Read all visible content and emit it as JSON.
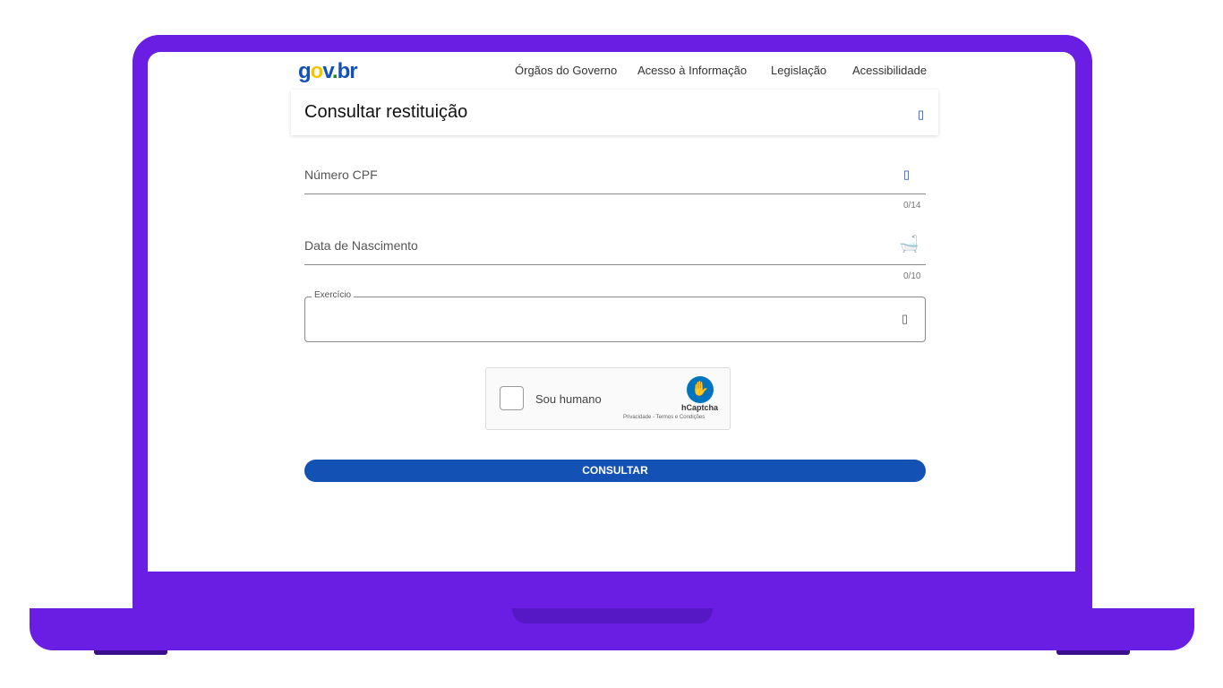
{
  "header": {
    "logo_parts": [
      "g",
      "o",
      "v",
      ".",
      "br"
    ],
    "nav": [
      "Órgãos do Governo",
      "Acesso à Informação",
      "Legislação",
      "Acessibilidade"
    ]
  },
  "page": {
    "title": "Consultar restituição"
  },
  "form": {
    "cpf": {
      "label": "Número CPF",
      "counter": "0/14",
      "icon": "info-icon"
    },
    "birth": {
      "label": "Data de Nascimento",
      "counter": "0/10",
      "icon": "calendar-icon"
    },
    "year": {
      "label": "Exercício",
      "icon": "dropdown-icon"
    }
  },
  "captcha": {
    "label": "Sou humano",
    "brand": "hCaptcha",
    "links": "Privacidade - Termos e Condições"
  },
  "submit": {
    "label": "CONSULTAR"
  },
  "colors": {
    "frame": "#6a1de3",
    "primary": "#1351b4"
  }
}
